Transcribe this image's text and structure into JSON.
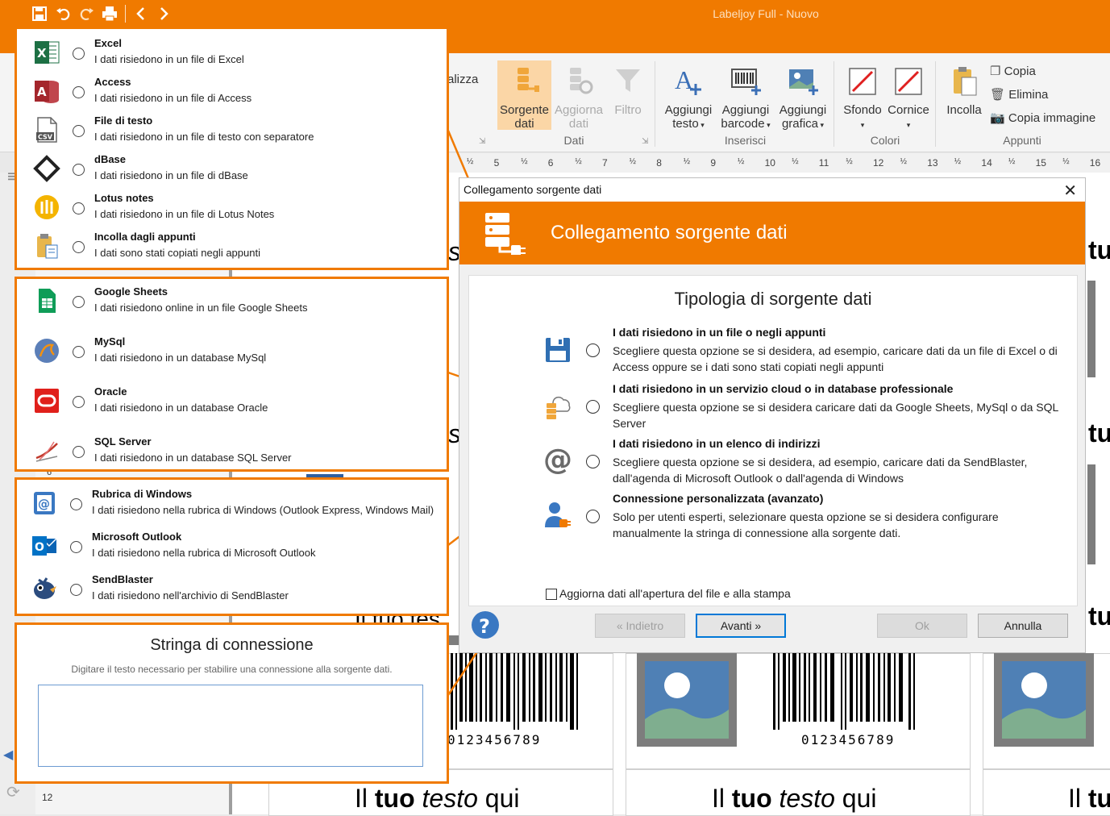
{
  "window": {
    "title": "Labeljoy Full - Nuovo"
  },
  "ribbon": {
    "partial_tab": "alizza",
    "buttons": {
      "sorgente_dati": "Sorgente dati",
      "aggiorna_dati": "Aggiorna dati",
      "filtro": "Filtro",
      "aggiungi_testo": "Aggiungi testo",
      "aggiungi_barcode": "Aggiungi barcode",
      "aggiungi_grafica": "Aggiungi grafica",
      "sfondo": "Sfondo",
      "cornice": "Cornice",
      "incolla": "Incolla",
      "copia": "Copia",
      "elimina": "Elimina",
      "copia_immagine": "Copia immagine"
    },
    "groups": {
      "dati": "Dati",
      "inserisci": "Inserisci",
      "colori": "Colori",
      "appunti": "Appunti"
    }
  },
  "ruler": {
    "marks": [
      "½",
      "5",
      "½",
      "6",
      "½",
      "7",
      "½",
      "8",
      "½",
      "9",
      "½",
      "10",
      "½",
      "11",
      "½",
      "12",
      "½",
      "13",
      "½",
      "14",
      "½",
      "15",
      "½",
      "16"
    ]
  },
  "file_sources": [
    {
      "icon": "excel-icon",
      "title": "Excel",
      "desc": "I dati risiedono in un file di Excel"
    },
    {
      "icon": "access-icon",
      "title": "Access",
      "desc": "I dati risiedono in un file di Access"
    },
    {
      "icon": "csv-file-icon",
      "title": "File di testo",
      "desc": "I dati risiedono in un file di testo con separatore"
    },
    {
      "icon": "dbase-icon",
      "title": "dBase",
      "desc": "I dati risiedono in un file di dBase"
    },
    {
      "icon": "lotus-notes-icon",
      "title": "Lotus notes",
      "desc": "I dati risiedono in un file di Lotus Notes"
    },
    {
      "icon": "clipboard-icon",
      "title": "Incolla dagli appunti",
      "desc": "I dati sono stati copiati negli appunti"
    }
  ],
  "cloud_sources": [
    {
      "icon": "google-sheets-icon",
      "title": "Google Sheets",
      "desc": "I dati risiedono online in un file Google Sheets"
    },
    {
      "icon": "mysql-icon",
      "title": "MySql",
      "desc": "I dati risiedono in un database MySql"
    },
    {
      "icon": "oracle-icon",
      "title": "Oracle",
      "desc": "I dati risiedono in un database Oracle"
    },
    {
      "icon": "sql-server-icon",
      "title": "SQL Server",
      "desc": "I dati risiedono in un database SQL Server"
    }
  ],
  "address_sources": [
    {
      "icon": "windows-contacts-icon",
      "title": "Rubrica di Windows",
      "desc": "I dati risiedono nella rubrica di Windows (Outlook Express, Windows Mail)"
    },
    {
      "icon": "outlook-icon",
      "title": "Microsoft Outlook",
      "desc": "I dati risiedono nella rubrica di Microsoft Outlook"
    },
    {
      "icon": "sendblaster-icon",
      "title": "SendBlaster",
      "desc": "I dati risiedono nell'archivio di SendBlaster"
    }
  ],
  "connection_panel": {
    "title": "Stringa di connessione",
    "desc": "Digitare il testo necessario per stabilire una connessione alla sorgente dati.",
    "value": ""
  },
  "dialog": {
    "title": "Collegamento sorgente dati",
    "header": "Collegamento sorgente dati",
    "subtitle": "Tipologia di sorgente dati",
    "options": [
      {
        "title": "I dati risiedono in un file o negli appunti",
        "desc": "Scegliere questa opzione se si desidera, ad esempio, caricare dati da un file di Excel o di Access oppure se i dati sono stati copiati negli appunti"
      },
      {
        "title": "I dati risiedono in un servizio cloud o in database professionale",
        "desc": "Scegliere questa opzione se si desidera caricare dati da Google Sheets, MySql o da SQL Server"
      },
      {
        "title": "I dati risiedono in un elenco di indirizzi",
        "desc": "Scegliere questa opzione se si desidera, ad esempio, caricare dati da SendBlaster, dall'agenda di Microsoft Outlook o dall'agenda di Windows"
      },
      {
        "title": "Connessione personalizzata (avanzato)",
        "desc": "Solo per utenti esperti, selezionare questa opzione se si desidera configurare manualmente la stringa di connessione alla sorgente dati."
      }
    ],
    "checkbox_label": "Aggiorna dati all'apertura del file e alla stampa",
    "buttons": {
      "back": "« Indietro",
      "next": "Avanti »",
      "ok": "Ok",
      "cancel": "Annulla"
    }
  },
  "labels": {
    "barcode_number": "0123456789",
    "text_normal_1": "Il",
    "text_bold": "tuo",
    "text_italic": "testo",
    "text_normal_2": "qui",
    "partial_tu": "tu",
    "partial_s": "s",
    "partial_tuo_tes": "Il tuo tes"
  },
  "ruler_left": {
    "mark_6": "6",
    "mark_12": "12"
  },
  "colors": {
    "accent": "#F07A00",
    "primary_button_border": "#0078d7"
  }
}
